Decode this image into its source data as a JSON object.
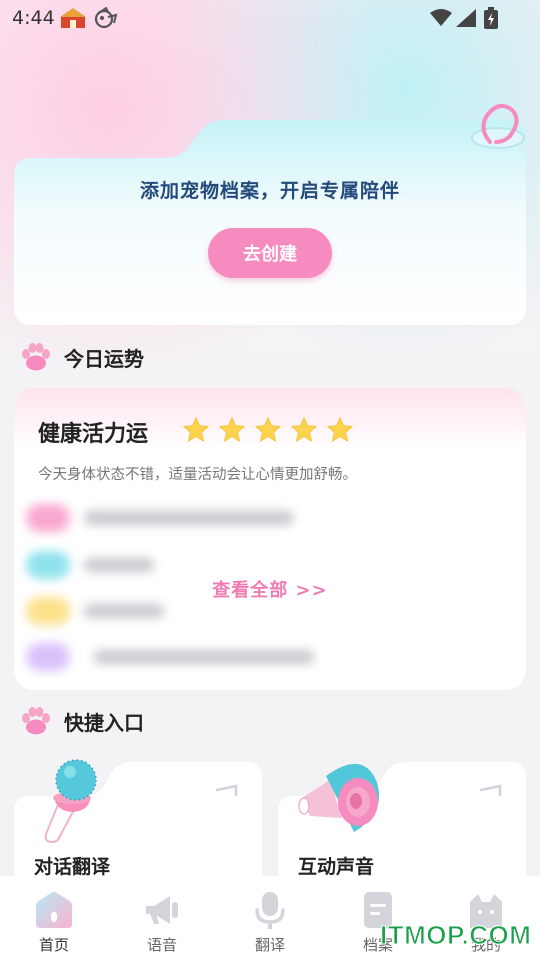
{
  "status_bar": {
    "time": "4:44",
    "icons": [
      "app-notification-icon",
      "app-notification-icon-2",
      "wifi-icon",
      "signal-icon",
      "battery-icon"
    ]
  },
  "create_card": {
    "title": "添加宠物档案，开启专属陪伴",
    "button_label": "去创建"
  },
  "fortune_section": {
    "title": "今日运势",
    "card": {
      "name": "健康活力运",
      "stars": 5,
      "star_color": "#fcd34d",
      "description": "今天身体状态不错，适量活动会让心情更加舒畅。",
      "view_all_label": "查看全部 >>"
    }
  },
  "quick_section": {
    "title": "快捷入口",
    "items": [
      {
        "label": "对话翻译",
        "icon": "microphone-icon"
      },
      {
        "label": "互动声音",
        "icon": "megaphone-icon"
      }
    ]
  },
  "bottom_nav": {
    "items": [
      {
        "label": "首页",
        "icon": "home-icon",
        "active": true
      },
      {
        "label": "语音",
        "icon": "megaphone-icon",
        "active": false
      },
      {
        "label": "翻译",
        "icon": "microphone-icon",
        "active": false
      },
      {
        "label": "档案",
        "icon": "document-icon",
        "active": false
      },
      {
        "label": "我的",
        "icon": "cat-profile-icon",
        "active": false
      }
    ]
  },
  "watermark": "ITMOP.COM",
  "colors": {
    "accent_pink": "#f58bbf",
    "title_blue": "#244a7c",
    "view_all_pink": "#f07bb2",
    "watermark_green": "#19a14a"
  }
}
